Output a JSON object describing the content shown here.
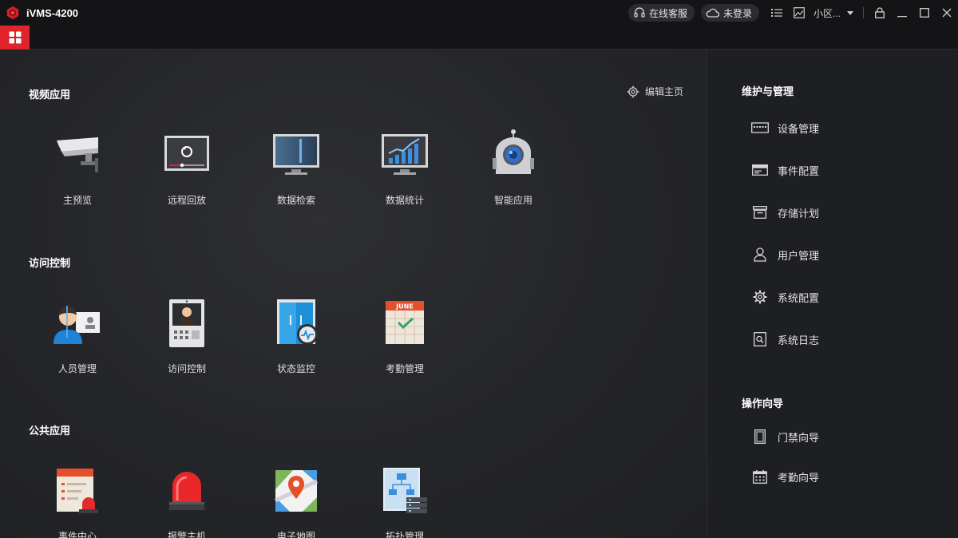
{
  "titlebar": {
    "app_title": "iVMS-4200",
    "online_service": "在线客服",
    "login_status": "未登录",
    "user_name": "小区..."
  },
  "main": {
    "edit_home": "编辑主页",
    "sections": [
      {
        "title": "视频应用",
        "items": [
          "主预览",
          "远程回放",
          "数据检索",
          "数据统计",
          "智能应用"
        ]
      },
      {
        "title": "访问控制",
        "items": [
          "人员管理",
          "访问控制",
          "状态监控",
          "考勤管理"
        ]
      },
      {
        "title": "公共应用",
        "items": [
          "事件中心",
          "报警主机",
          "电子地图",
          "拓扑管理"
        ]
      }
    ],
    "calendar_month": "JUNE"
  },
  "side": {
    "maintenance_title": "维护与管理",
    "maintenance_items": [
      "设备管理",
      "事件配置",
      "存储计划",
      "用户管理",
      "系统配置",
      "系统日志"
    ],
    "guide_title": "操作向导",
    "guide_items": [
      "门禁向导",
      "考勤向导"
    ]
  },
  "colors": {
    "brand_red": "#e0242b",
    "title_bar": "#141416",
    "panel": "#26272a",
    "accent_blue": "#2a8fe0"
  },
  "icons": {
    "window_controls": [
      "list-icon",
      "image-icon",
      "lock-icon",
      "minimize-icon",
      "maximize-icon",
      "close-icon"
    ]
  }
}
